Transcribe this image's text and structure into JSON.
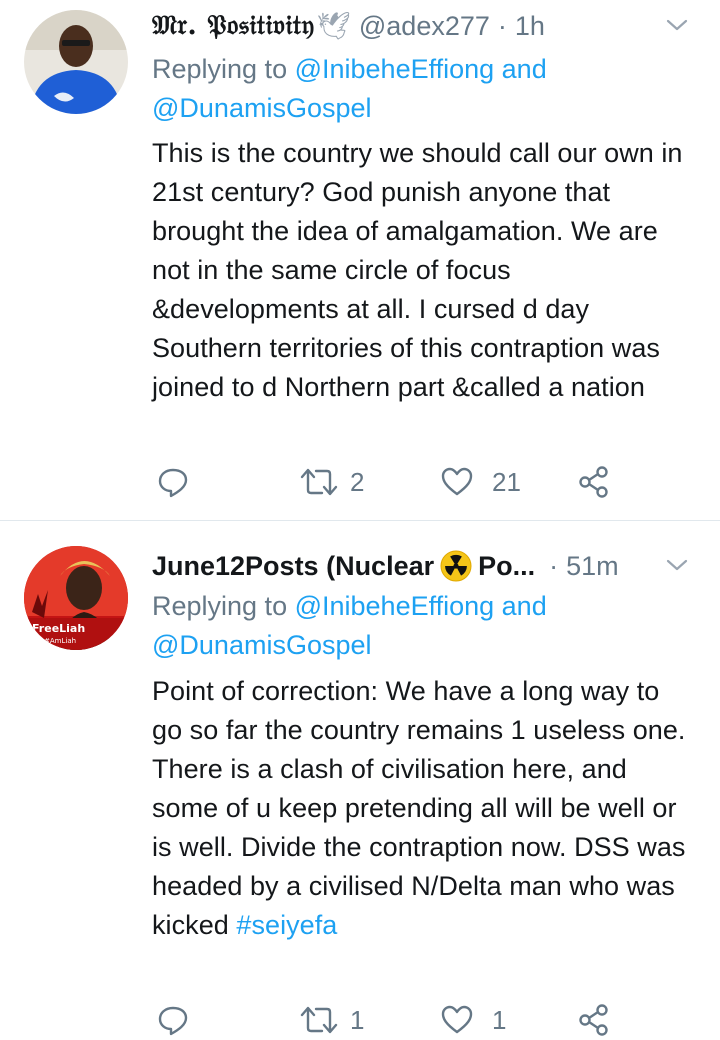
{
  "tweets": [
    {
      "display_name": "𝔐𝔯. 𝔓𝔬𝔰𝔦𝔱𝔦𝔳𝔦𝔱𝔶",
      "name_emoji": "🕊",
      "handle": "@adex277",
      "separator": "·",
      "time": "1h",
      "replying_prefix": "Replying to ",
      "replying_to_1": "@InibeheEffiong",
      "replying_and": " and",
      "replying_to_2": "@DunamisGospel",
      "body": "This is the country we should call our own in 21st century? God punish anyone that brought the idea of amalgamation. We are not in the same circle of focus &developments at all. I cursed d day Southern territories of this contraption was joined to d Northern part &called a nation",
      "hashtag": "",
      "actions": {
        "reply_count": "",
        "retweet_count": "2",
        "like_count": "21"
      }
    },
    {
      "display_name": "June12Posts (Nuclear",
      "name_emoji": "☢",
      "name_suffix": "Po...",
      "handle": "",
      "separator": "·",
      "time": "51m",
      "avatar_text": "FreeLiah",
      "avatar_subtext": "#AmLiah",
      "replying_prefix": "Replying to ",
      "replying_to_1": "@InibeheEffiong",
      "replying_and": " and",
      "replying_to_2": "@DunamisGospel",
      "body": "Point of correction: We have a long way to go so far the country remains 1 useless one. There is a clash of civilisation here, and some of u keep pretending all will be well or is well. Divide the contraption now. DSS was headed by a civilised N/Delta man who was kicked ",
      "hashtag": "#seiyefa",
      "actions": {
        "reply_count": "",
        "retweet_count": "1",
        "like_count": "1"
      }
    }
  ],
  "colors": {
    "text": "#14171a",
    "secondary": "#657786",
    "link": "#1da1f2",
    "divider": "#e1e8ed",
    "radiation": "#f5c518"
  }
}
